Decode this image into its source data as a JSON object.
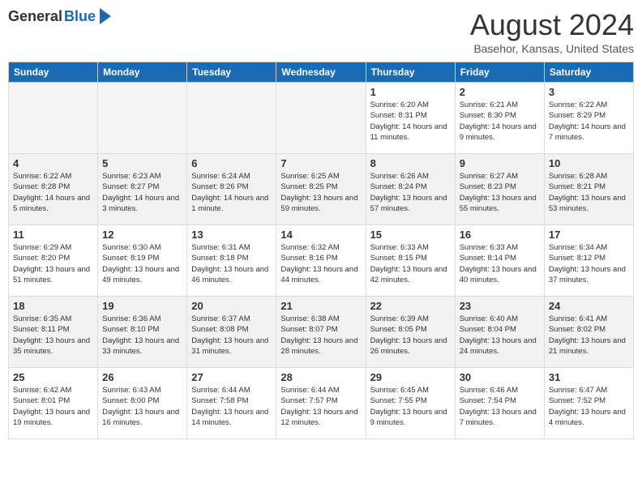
{
  "header": {
    "logo_general": "General",
    "logo_blue": "Blue",
    "month_title": "August 2024",
    "location": "Basehor, Kansas, United States"
  },
  "days_of_week": [
    "Sunday",
    "Monday",
    "Tuesday",
    "Wednesday",
    "Thursday",
    "Friday",
    "Saturday"
  ],
  "weeks": [
    [
      {
        "day": "",
        "empty": true
      },
      {
        "day": "",
        "empty": true
      },
      {
        "day": "",
        "empty": true
      },
      {
        "day": "",
        "empty": true
      },
      {
        "day": "1",
        "sunrise": "Sunrise: 6:20 AM",
        "sunset": "Sunset: 8:31 PM",
        "daylight": "Daylight: 14 hours and 11 minutes."
      },
      {
        "day": "2",
        "sunrise": "Sunrise: 6:21 AM",
        "sunset": "Sunset: 8:30 PM",
        "daylight": "Daylight: 14 hours and 9 minutes."
      },
      {
        "day": "3",
        "sunrise": "Sunrise: 6:22 AM",
        "sunset": "Sunset: 8:29 PM",
        "daylight": "Daylight: 14 hours and 7 minutes."
      }
    ],
    [
      {
        "day": "4",
        "sunrise": "Sunrise: 6:22 AM",
        "sunset": "Sunset: 8:28 PM",
        "daylight": "Daylight: 14 hours and 5 minutes."
      },
      {
        "day": "5",
        "sunrise": "Sunrise: 6:23 AM",
        "sunset": "Sunset: 8:27 PM",
        "daylight": "Daylight: 14 hours and 3 minutes."
      },
      {
        "day": "6",
        "sunrise": "Sunrise: 6:24 AM",
        "sunset": "Sunset: 8:26 PM",
        "daylight": "Daylight: 14 hours and 1 minute."
      },
      {
        "day": "7",
        "sunrise": "Sunrise: 6:25 AM",
        "sunset": "Sunset: 8:25 PM",
        "daylight": "Daylight: 13 hours and 59 minutes."
      },
      {
        "day": "8",
        "sunrise": "Sunrise: 6:26 AM",
        "sunset": "Sunset: 8:24 PM",
        "daylight": "Daylight: 13 hours and 57 minutes."
      },
      {
        "day": "9",
        "sunrise": "Sunrise: 6:27 AM",
        "sunset": "Sunset: 8:23 PM",
        "daylight": "Daylight: 13 hours and 55 minutes."
      },
      {
        "day": "10",
        "sunrise": "Sunrise: 6:28 AM",
        "sunset": "Sunset: 8:21 PM",
        "daylight": "Daylight: 13 hours and 53 minutes."
      }
    ],
    [
      {
        "day": "11",
        "sunrise": "Sunrise: 6:29 AM",
        "sunset": "Sunset: 8:20 PM",
        "daylight": "Daylight: 13 hours and 51 minutes."
      },
      {
        "day": "12",
        "sunrise": "Sunrise: 6:30 AM",
        "sunset": "Sunset: 8:19 PM",
        "daylight": "Daylight: 13 hours and 49 minutes."
      },
      {
        "day": "13",
        "sunrise": "Sunrise: 6:31 AM",
        "sunset": "Sunset: 8:18 PM",
        "daylight": "Daylight: 13 hours and 46 minutes."
      },
      {
        "day": "14",
        "sunrise": "Sunrise: 6:32 AM",
        "sunset": "Sunset: 8:16 PM",
        "daylight": "Daylight: 13 hours and 44 minutes."
      },
      {
        "day": "15",
        "sunrise": "Sunrise: 6:33 AM",
        "sunset": "Sunset: 8:15 PM",
        "daylight": "Daylight: 13 hours and 42 minutes."
      },
      {
        "day": "16",
        "sunrise": "Sunrise: 6:33 AM",
        "sunset": "Sunset: 8:14 PM",
        "daylight": "Daylight: 13 hours and 40 minutes."
      },
      {
        "day": "17",
        "sunrise": "Sunrise: 6:34 AM",
        "sunset": "Sunset: 8:12 PM",
        "daylight": "Daylight: 13 hours and 37 minutes."
      }
    ],
    [
      {
        "day": "18",
        "sunrise": "Sunrise: 6:35 AM",
        "sunset": "Sunset: 8:11 PM",
        "daylight": "Daylight: 13 hours and 35 minutes."
      },
      {
        "day": "19",
        "sunrise": "Sunrise: 6:36 AM",
        "sunset": "Sunset: 8:10 PM",
        "daylight": "Daylight: 13 hours and 33 minutes."
      },
      {
        "day": "20",
        "sunrise": "Sunrise: 6:37 AM",
        "sunset": "Sunset: 8:08 PM",
        "daylight": "Daylight: 13 hours and 31 minutes."
      },
      {
        "day": "21",
        "sunrise": "Sunrise: 6:38 AM",
        "sunset": "Sunset: 8:07 PM",
        "daylight": "Daylight: 13 hours and 28 minutes."
      },
      {
        "day": "22",
        "sunrise": "Sunrise: 6:39 AM",
        "sunset": "Sunset: 8:05 PM",
        "daylight": "Daylight: 13 hours and 26 minutes."
      },
      {
        "day": "23",
        "sunrise": "Sunrise: 6:40 AM",
        "sunset": "Sunset: 8:04 PM",
        "daylight": "Daylight: 13 hours and 24 minutes."
      },
      {
        "day": "24",
        "sunrise": "Sunrise: 6:41 AM",
        "sunset": "Sunset: 8:02 PM",
        "daylight": "Daylight: 13 hours and 21 minutes."
      }
    ],
    [
      {
        "day": "25",
        "sunrise": "Sunrise: 6:42 AM",
        "sunset": "Sunset: 8:01 PM",
        "daylight": "Daylight: 13 hours and 19 minutes."
      },
      {
        "day": "26",
        "sunrise": "Sunrise: 6:43 AM",
        "sunset": "Sunset: 8:00 PM",
        "daylight": "Daylight: 13 hours and 16 minutes."
      },
      {
        "day": "27",
        "sunrise": "Sunrise: 6:44 AM",
        "sunset": "Sunset: 7:58 PM",
        "daylight": "Daylight: 13 hours and 14 minutes."
      },
      {
        "day": "28",
        "sunrise": "Sunrise: 6:44 AM",
        "sunset": "Sunset: 7:57 PM",
        "daylight": "Daylight: 13 hours and 12 minutes."
      },
      {
        "day": "29",
        "sunrise": "Sunrise: 6:45 AM",
        "sunset": "Sunset: 7:55 PM",
        "daylight": "Daylight: 13 hours and 9 minutes."
      },
      {
        "day": "30",
        "sunrise": "Sunrise: 6:46 AM",
        "sunset": "Sunset: 7:54 PM",
        "daylight": "Daylight: 13 hours and 7 minutes."
      },
      {
        "day": "31",
        "sunrise": "Sunrise: 6:47 AM",
        "sunset": "Sunset: 7:52 PM",
        "daylight": "Daylight: 13 hours and 4 minutes."
      }
    ]
  ]
}
